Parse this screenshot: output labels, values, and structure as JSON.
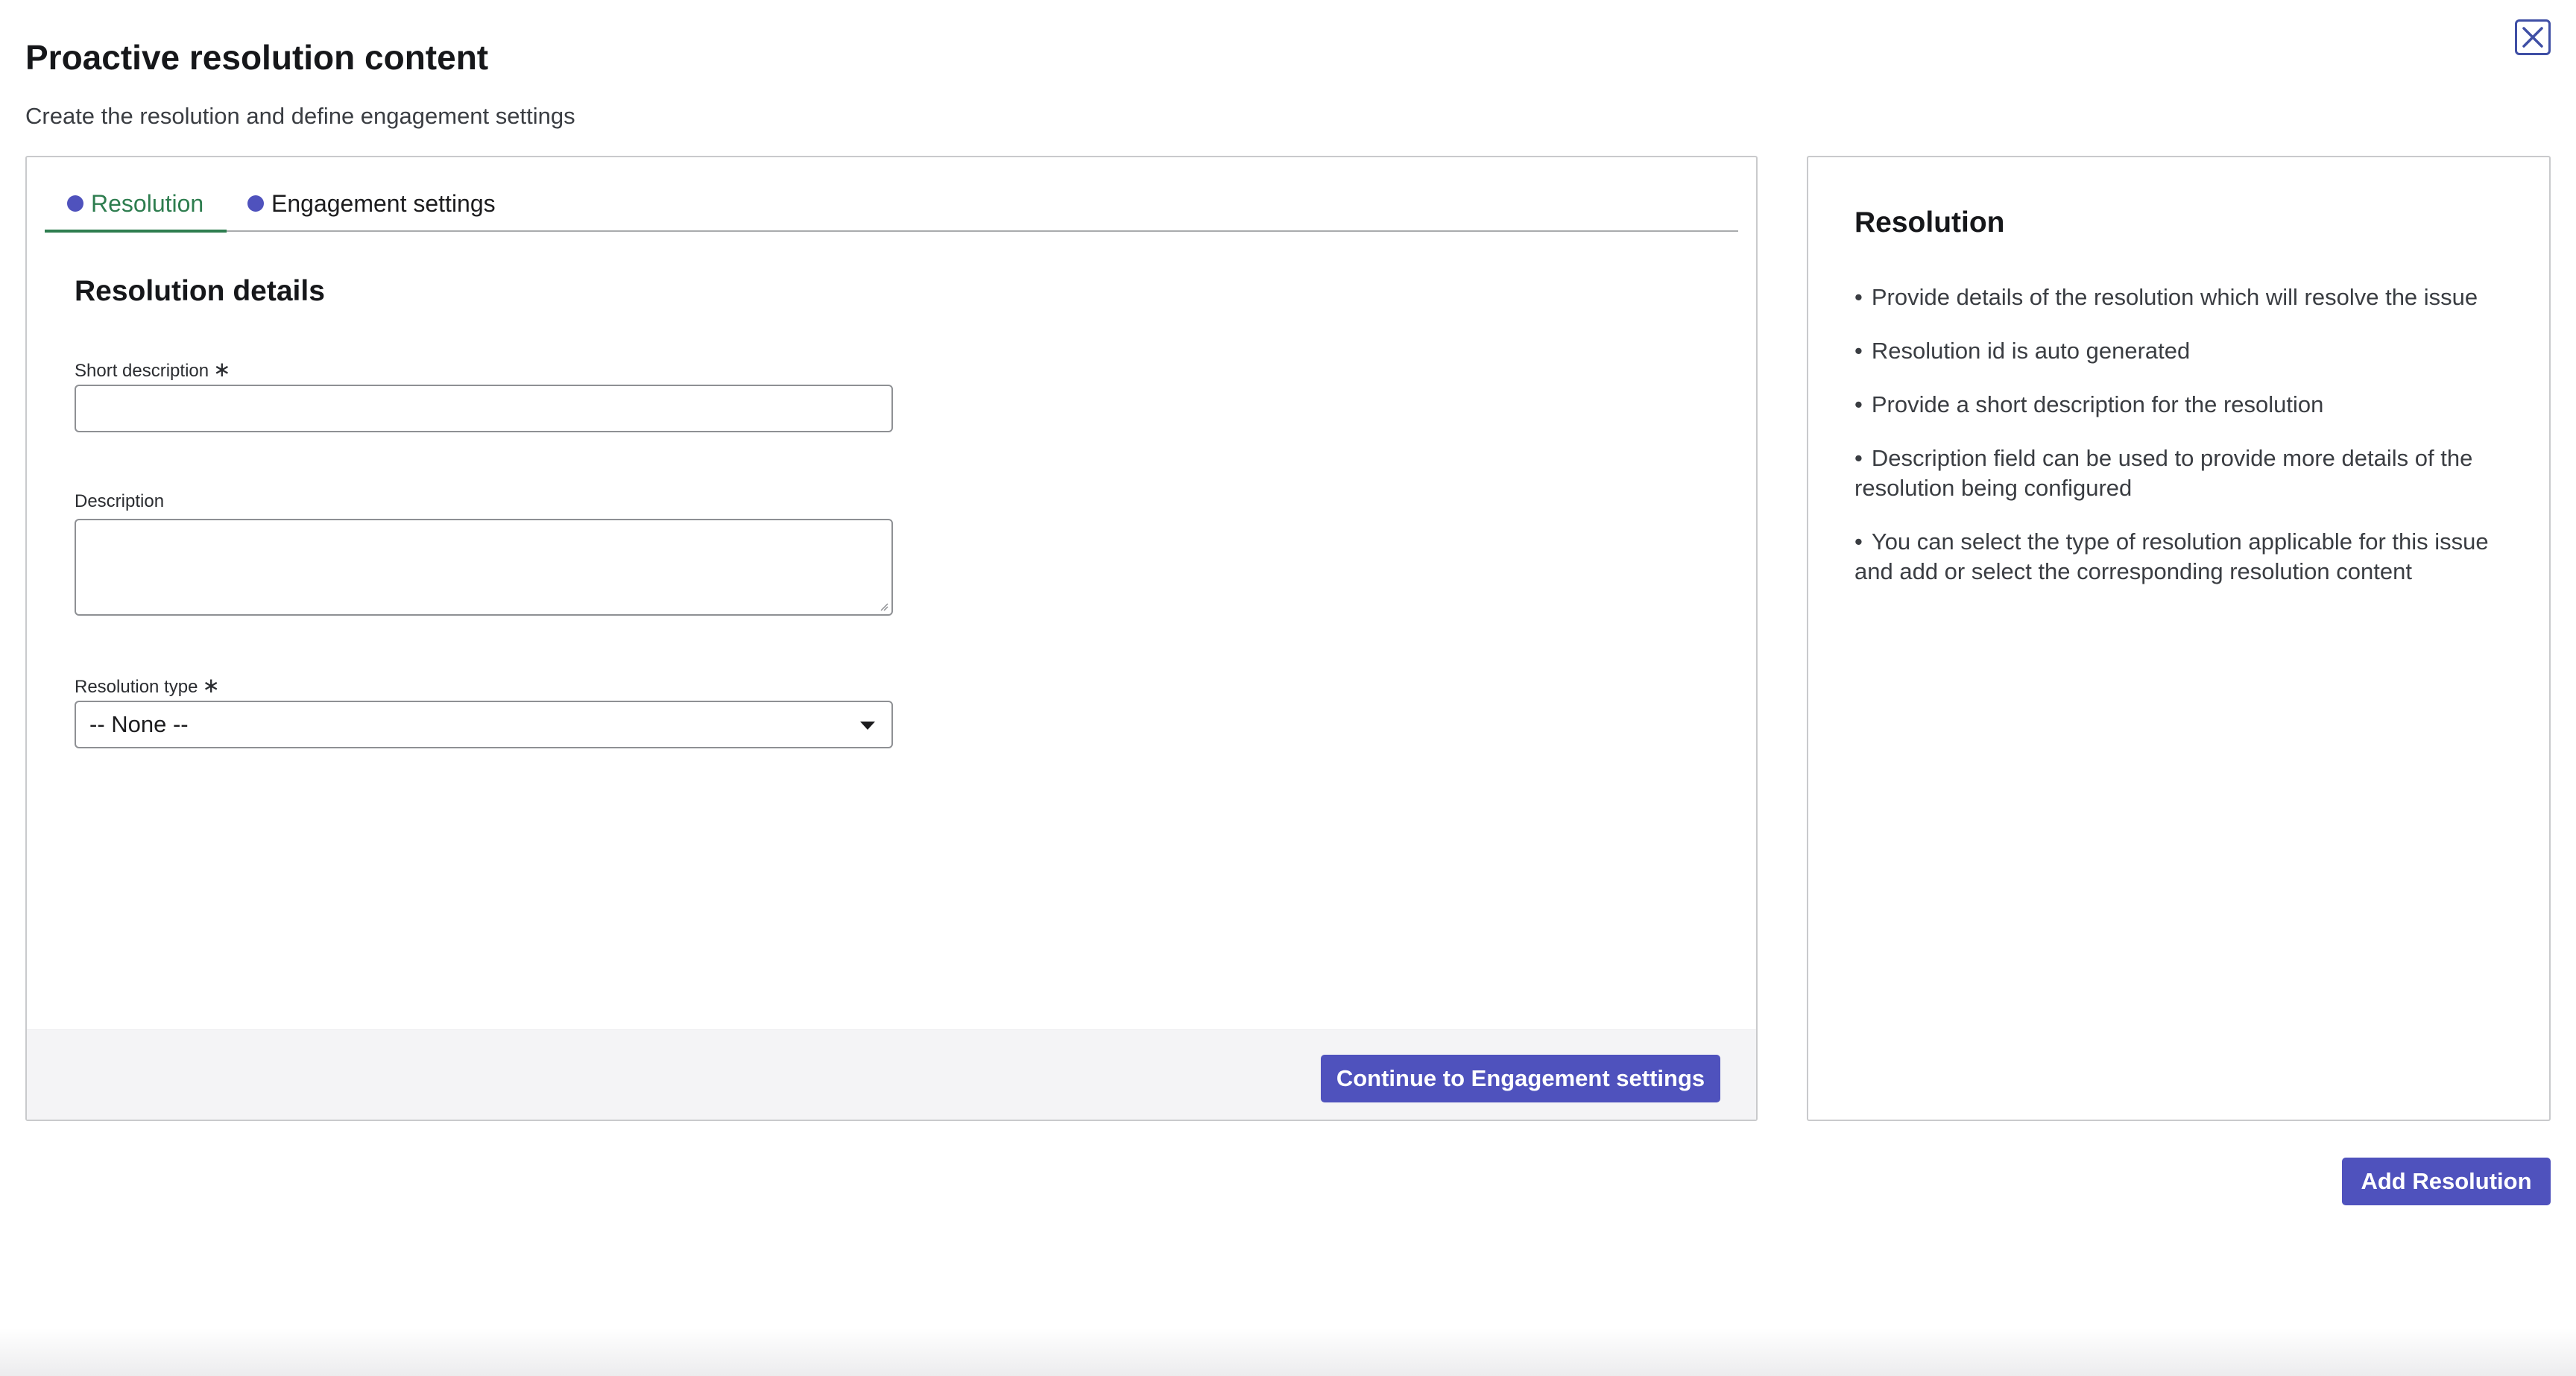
{
  "header": {
    "title": "Proactive resolution content",
    "subtitle": "Create the resolution and define engagement settings"
  },
  "tabs": [
    {
      "label": "Resolution",
      "active": true
    },
    {
      "label": "Engagement settings",
      "active": false
    }
  ],
  "form": {
    "section_title": "Resolution details",
    "short_description": {
      "label": "Short description",
      "value": "",
      "required_mark": "∗"
    },
    "description": {
      "label": "Description",
      "value": ""
    },
    "resolution_type": {
      "label": "Resolution type",
      "required_mark": "∗",
      "selected": "-- None --"
    }
  },
  "footer": {
    "continue_label": "Continue to Engagement settings"
  },
  "help": {
    "title": "Resolution",
    "items": [
      "Provide details of the resolution which will resolve the issue",
      "Resolution id is auto generated",
      "Provide a short description for the resolution",
      "Description field can be used to provide more details of the resolution being configured",
      "You can select the type of resolution applicable for this issue and add or select the corresponding resolution content"
    ]
  },
  "actions": {
    "add_resolution_label": "Add Resolution"
  },
  "colors": {
    "primary": "#4f52bd",
    "active_tab": "#2e7d4f",
    "close_border": "#3f4fa5"
  },
  "icons": {
    "close": "close-icon",
    "caret": "chevron-down-icon",
    "tab_dot": "status-dot-icon"
  }
}
